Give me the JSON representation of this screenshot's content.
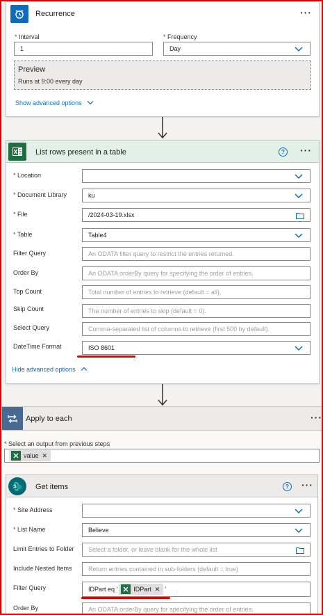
{
  "recurrence": {
    "title": "Recurrence",
    "icon": "alarm-clock-icon",
    "color": "#0f6cbd",
    "interval_label": "Interval",
    "interval_value": "1",
    "frequency_label": "Frequency",
    "frequency_value": "Day",
    "preview_title": "Preview",
    "preview_text": "Runs at 9:00 every day",
    "advanced_link": "Show advanced options"
  },
  "list_rows": {
    "title": "List rows present in a table",
    "icon": "excel-icon",
    "header_color": "#e3f0e8",
    "fields": {
      "location_label": "Location",
      "location_value": "",
      "library_label": "Document Library",
      "library_value": "ku",
      "file_label": "File",
      "file_value": "/2024-03-19.xlsx",
      "table_label": "Table",
      "table_value": "Table4",
      "filter_label": "Filter Query",
      "filter_placeholder": "An ODATA filter query to restrict the entries returned.",
      "orderby_label": "Order By",
      "orderby_placeholder": "An ODATA orderBy query for specifying the order of entries.",
      "top_label": "Top Count",
      "top_placeholder": "Total number of entries to retrieve (default = all).",
      "skip_label": "Skip Count",
      "skip_placeholder": "The number of entries to skip (default = 0).",
      "select_label": "Select Query",
      "select_placeholder": "Comma-separated list of columns to retrieve (first 500 by default).",
      "datetime_label": "DateTime Format",
      "datetime_value": "ISO 8601"
    },
    "advanced_link": "Hide advanced options"
  },
  "apply_each": {
    "title": "Apply to each",
    "icon": "loop-icon",
    "color": "#486991",
    "select_label": "Select an output from previous steps",
    "token": "value"
  },
  "get_items": {
    "title": "Get items",
    "icon": "sharepoint-icon",
    "color": "#036c70",
    "fields": {
      "site_label": "Site Address",
      "site_value": "",
      "list_label": "List Name",
      "list_value": "Believe",
      "folder_label": "Limit Entries to Folder",
      "folder_placeholder": "Select a folder, or leave blank for the whole list",
      "nested_label": "Include Nested Items",
      "nested_placeholder": "Return entries contained in sub-folders (default = true)",
      "filter_label": "Filter Query",
      "filter_prefix": "IDPart eq '",
      "filter_token": "IDPart",
      "filter_suffix": "'",
      "orderby_label": "Order By",
      "orderby_placeholder": "An ODATA orderBy query for specifying the order of entries."
    }
  }
}
